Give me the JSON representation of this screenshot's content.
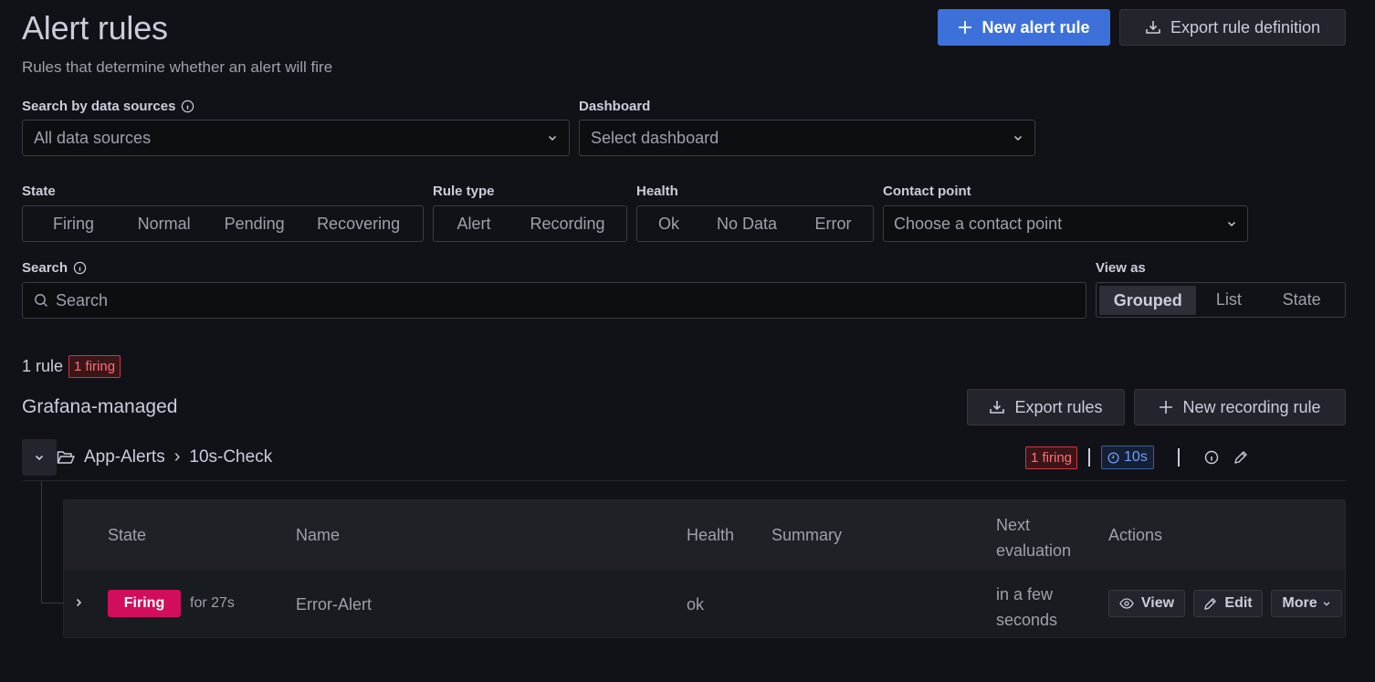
{
  "header": {
    "title": "Alert rules",
    "subtitle": "Rules that determine whether an alert will fire",
    "new_alert_rule": "New alert rule",
    "export_rule_definition": "Export rule definition"
  },
  "filters": {
    "data_sources_label": "Search by data sources",
    "data_sources_value": "All data sources",
    "dashboard_label": "Dashboard",
    "dashboard_placeholder": "Select dashboard",
    "state_label": "State",
    "state_options": [
      "Firing",
      "Normal",
      "Pending",
      "Recovering"
    ],
    "rule_type_label": "Rule type",
    "rule_type_options": [
      "Alert",
      "Recording"
    ],
    "health_label": "Health",
    "health_options": [
      "Ok",
      "No Data",
      "Error"
    ],
    "contact_point_label": "Contact point",
    "contact_point_placeholder": "Choose a contact point",
    "search_label": "Search",
    "search_placeholder": "Search",
    "view_as_label": "View as",
    "view_as_options": [
      "Grouped",
      "List",
      "State"
    ],
    "view_as_selected": "Grouped"
  },
  "summary": {
    "rule_count": "1 rule",
    "firing_badge": "1 firing"
  },
  "section": {
    "title": "Grafana-managed",
    "export_rules": "Export rules",
    "new_recording_rule": "New recording rule"
  },
  "group": {
    "folder": "App-Alerts",
    "separator": "›",
    "name": "10s-Check",
    "firing_badge": "1 firing",
    "interval": "10s"
  },
  "table": {
    "headers": {
      "state": "State",
      "name": "Name",
      "health": "Health",
      "summary": "Summary",
      "next_eval_line1": "Next",
      "next_eval_line2": "evaluation",
      "actions": "Actions"
    },
    "rows": [
      {
        "state": "Firing",
        "duration": "for 27s",
        "name": "Error-Alert",
        "health": "ok",
        "summary": "",
        "next_eval_line1": "in a few",
        "next_eval_line2": "seconds",
        "view": "View",
        "edit": "Edit",
        "more": "More"
      }
    ]
  },
  "colors": {
    "background": "#111217",
    "primary": "#3d71d9",
    "firing": "#d10e5c",
    "interval": "#6e9fff"
  }
}
